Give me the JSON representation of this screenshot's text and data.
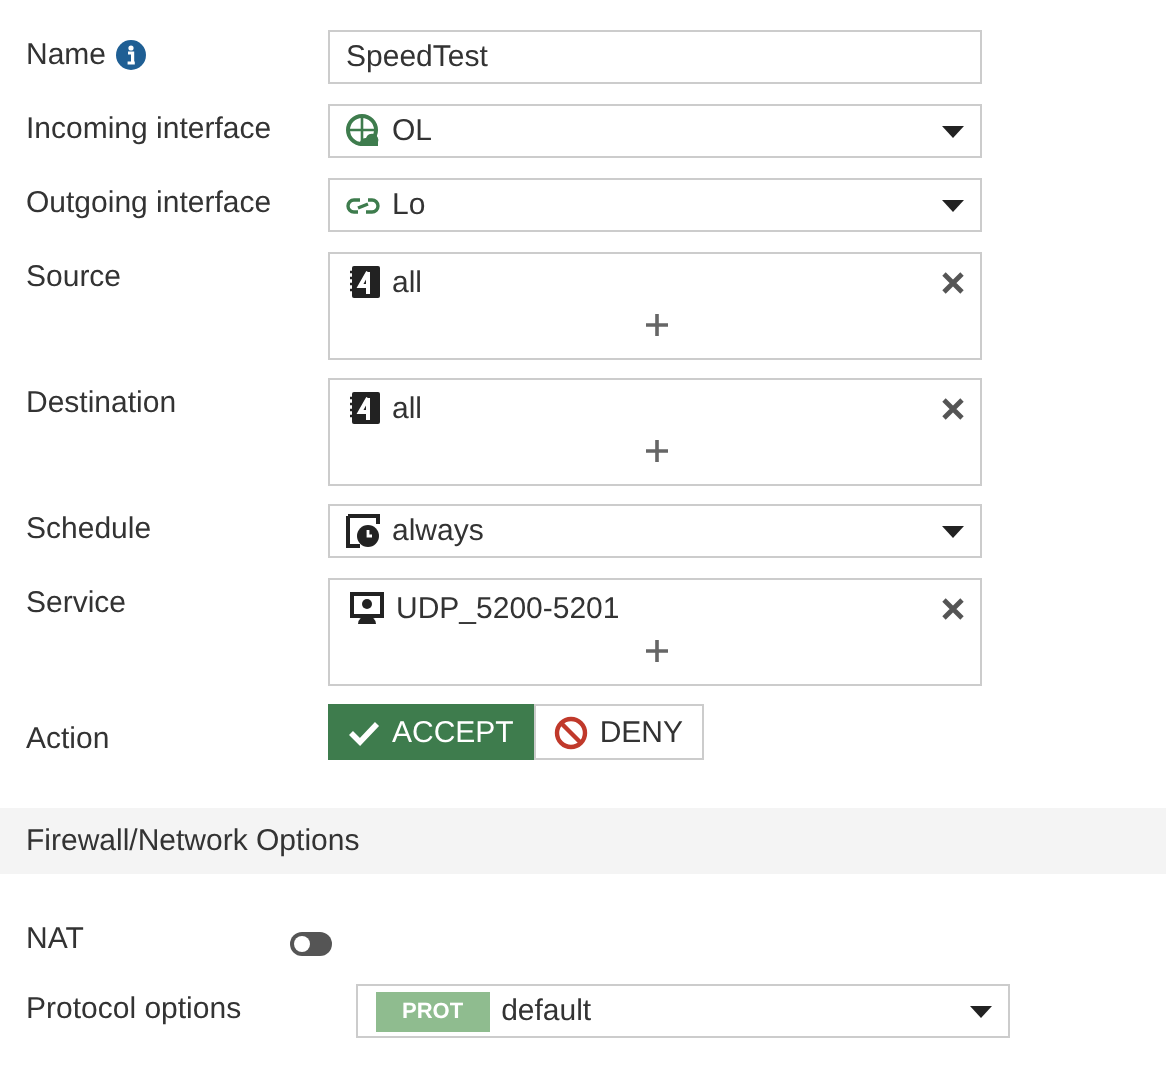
{
  "fields": [
    {
      "kind": "text",
      "label": "Name",
      "info": true,
      "value": "SpeedTest"
    },
    {
      "kind": "select",
      "label": "Incoming interface",
      "value": {
        "kind": "globe",
        "text": "OL"
      }
    },
    {
      "kind": "select",
      "label": "Outgoing interface",
      "value": {
        "kind": "link",
        "text": "Lo"
      }
    },
    {
      "kind": "multi",
      "label": "Source",
      "items": [
        {
          "kind": "address",
          "text": "all"
        }
      ]
    },
    {
      "kind": "multi",
      "label": "Destination",
      "items": [
        {
          "kind": "address",
          "text": "all"
        }
      ]
    },
    {
      "kind": "select",
      "label": "Schedule",
      "value": {
        "kind": "schedule",
        "text": "always"
      }
    },
    {
      "kind": "multi",
      "label": "Service",
      "items": [
        {
          "kind": "service",
          "text": "UDP_5200-5201"
        }
      ]
    },
    {
      "kind": "action",
      "label": "Action",
      "options": [
        {
          "kind": "accept",
          "label": "ACCEPT",
          "selected": true
        },
        {
          "kind": "deny",
          "label": "DENY",
          "selected": false
        }
      ]
    }
  ],
  "section": {
    "title": "Firewall/Network Options"
  },
  "nat": {
    "label": "NAT",
    "on": false
  },
  "protocol_options": {
    "label": "Protocol options",
    "badge": "PROT",
    "value": "default"
  }
}
